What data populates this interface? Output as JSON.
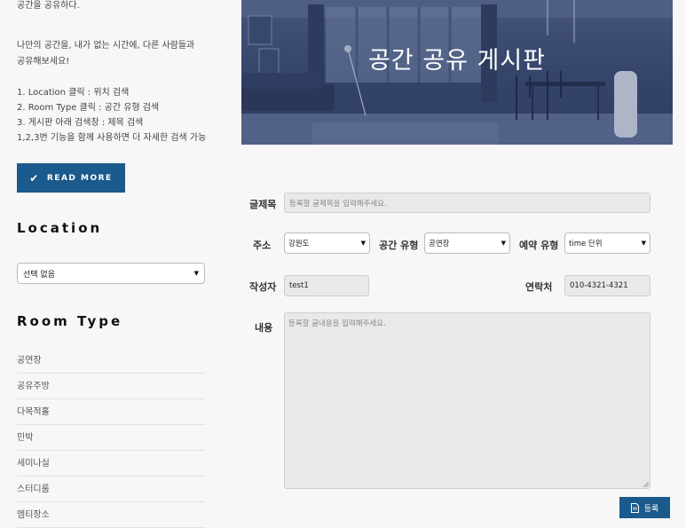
{
  "intro": {
    "top_fragment": "공간을 공유하다.",
    "paragraph_line1": "나만의 공간을, 내가 없는 시간에, 다른 사람들과",
    "paragraph_line2": "공유해보세요!",
    "steps": [
      "1. Location 클릭 : 위치 검색",
      "2. Room Type 클릭 : 공간 유형 검색",
      "3. 게시판 아래 검색창 : 제목 검색",
      "1,2,3번 기능을 함께 사용하면 더 자세한 검색 가능"
    ]
  },
  "read_more": {
    "label": "READ MORE",
    "icon": "check-icon"
  },
  "location": {
    "title": "Location",
    "selected": "선택 없음"
  },
  "room_type": {
    "title": "Room Type",
    "items": [
      "공연장",
      "공유주방",
      "다목적홀",
      "민박",
      "세미나실",
      "스터디룸",
      "엠티장소"
    ]
  },
  "banner": {
    "title": "공간 공유 게시판"
  },
  "form": {
    "title_label": "글제목",
    "title_placeholder": "등록할 글제목을 입력해주세요.",
    "address_label": "주소",
    "address_value": "강원도",
    "space_type_label": "공간 유형",
    "space_type_value": "공연장",
    "reservation_label": "예약 유형",
    "reservation_value": "time 단위",
    "author_label": "작성자",
    "author_value": "test1",
    "contact_label": "연락처",
    "contact_value": "010-4321-4321",
    "content_label": "내용",
    "content_placeholder": "등록할 글내용을 입력해주세요.",
    "submit_label": "등록",
    "submit_icon": "document-icon"
  },
  "colors": {
    "accent": "#1b5a8c",
    "banner_overlay": "#3a4a70"
  }
}
